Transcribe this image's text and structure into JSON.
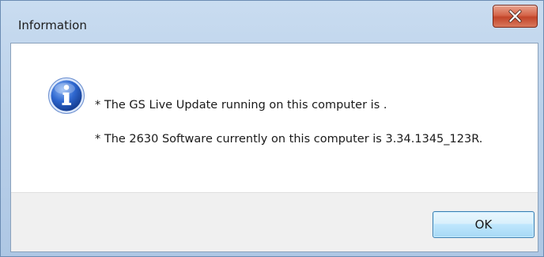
{
  "dialog": {
    "title": "Information",
    "icon": "information-icon",
    "messages": [
      "* The GS Live Update running on this computer is .",
      "* The 2630 Software currently on this computer is 3.34.1345_123R."
    ],
    "ok_label": "OK"
  },
  "titlebar": {
    "close_icon": "close-icon"
  },
  "colors": {
    "close_button": "#c9533a",
    "info_icon": "#2b61c4",
    "ok_border": "#3c7fb1",
    "footer_bg": "#f0f0f0"
  }
}
